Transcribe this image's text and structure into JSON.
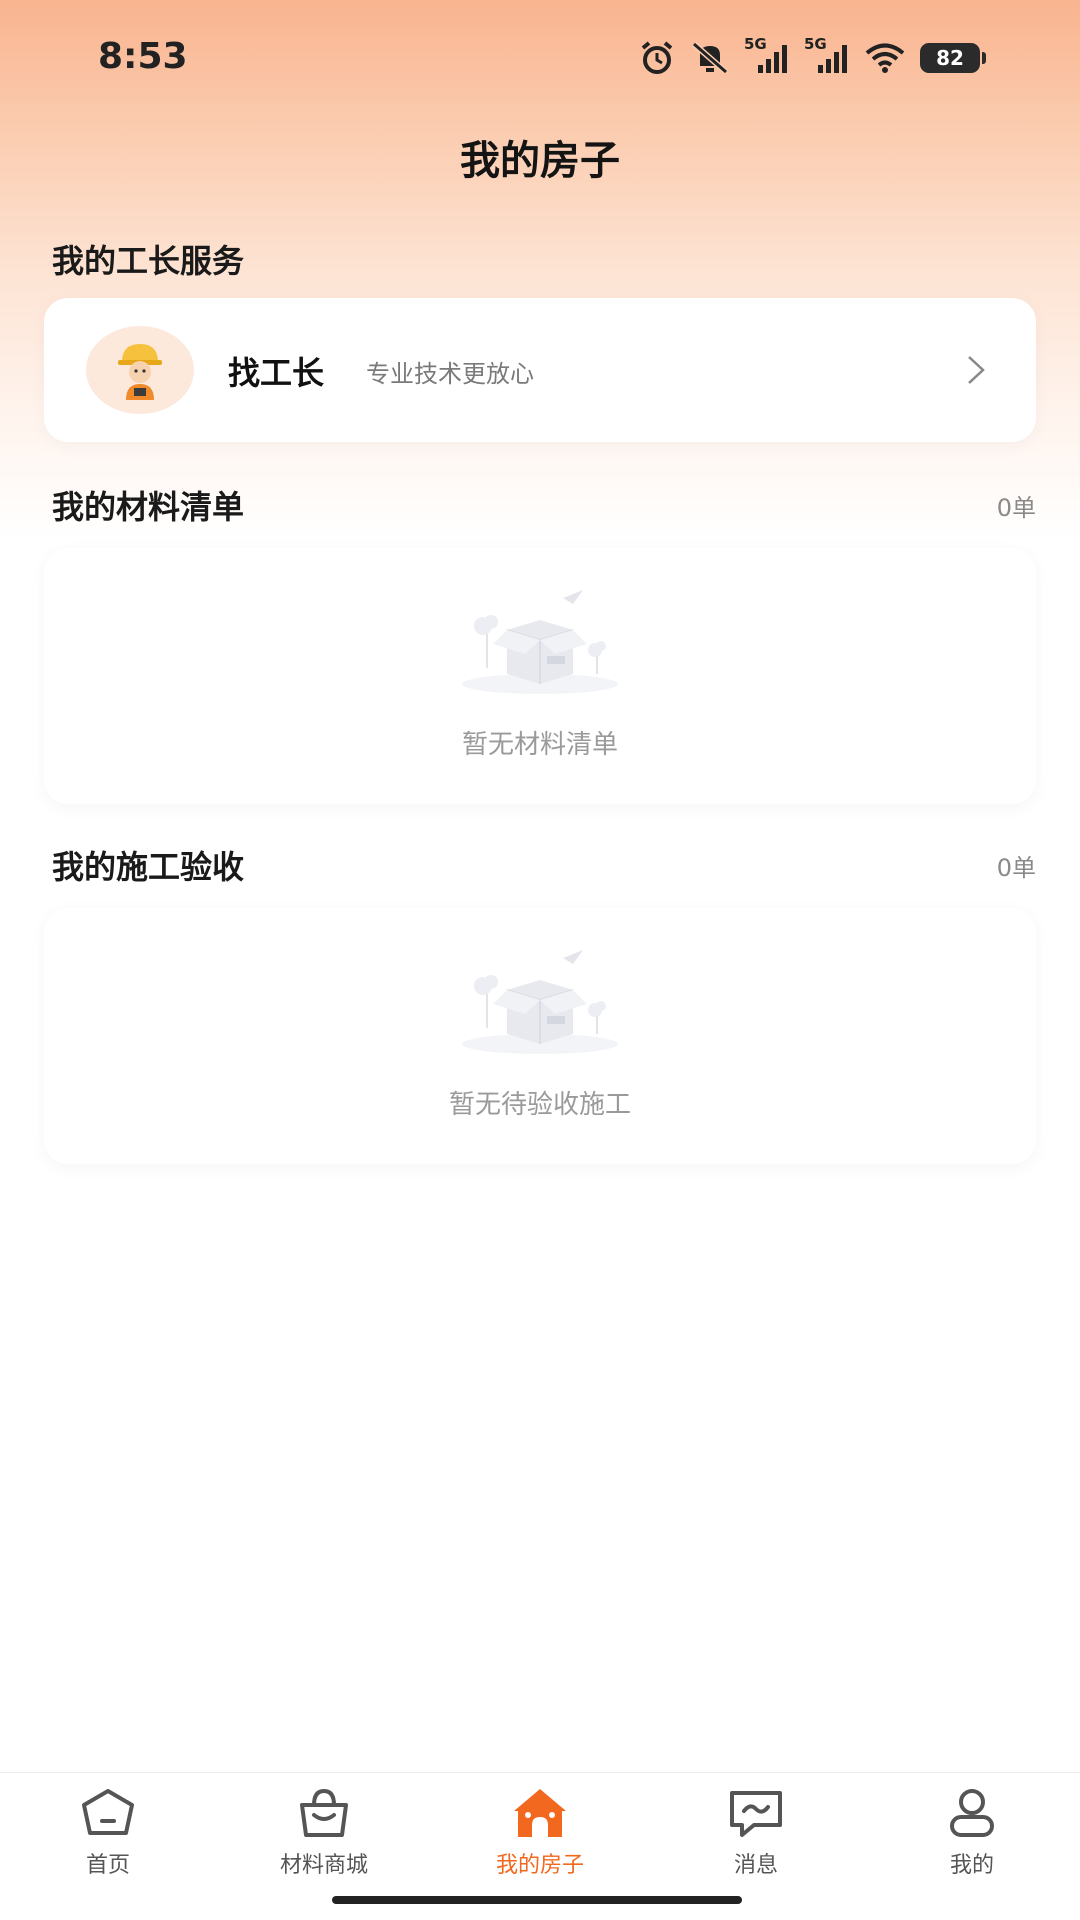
{
  "status_bar": {
    "time": "8:53",
    "icons": [
      "alarm-icon",
      "mute-icon",
      "signal-5g-icon",
      "signal-5g-icon",
      "wifi-icon"
    ],
    "network_label_1": "5G",
    "network_label_2": "5G",
    "battery": "82"
  },
  "page": {
    "title": "我的房子"
  },
  "foreman_section": {
    "title": "我的工长服务",
    "card_title": "找工长",
    "card_subtitle": "专业技术更放心"
  },
  "materials_section": {
    "title": "我的材料清单",
    "count": "0单",
    "empty_text": "暂无材料清单"
  },
  "acceptance_section": {
    "title": "我的施工验收",
    "count": "0单",
    "empty_text": "暂无待验收施工"
  },
  "tabbar": {
    "tabs": [
      {
        "label": "首页",
        "icon": "home-icon"
      },
      {
        "label": "材料商城",
        "icon": "shopping-bag-icon"
      },
      {
        "label": "我的房子",
        "icon": "house-icon"
      },
      {
        "label": "消息",
        "icon": "message-icon"
      },
      {
        "label": "我的",
        "icon": "person-icon"
      }
    ],
    "active_index": 2
  },
  "colors": {
    "accent": "#f2681e",
    "header_gradient_top": "#f9b48f"
  }
}
